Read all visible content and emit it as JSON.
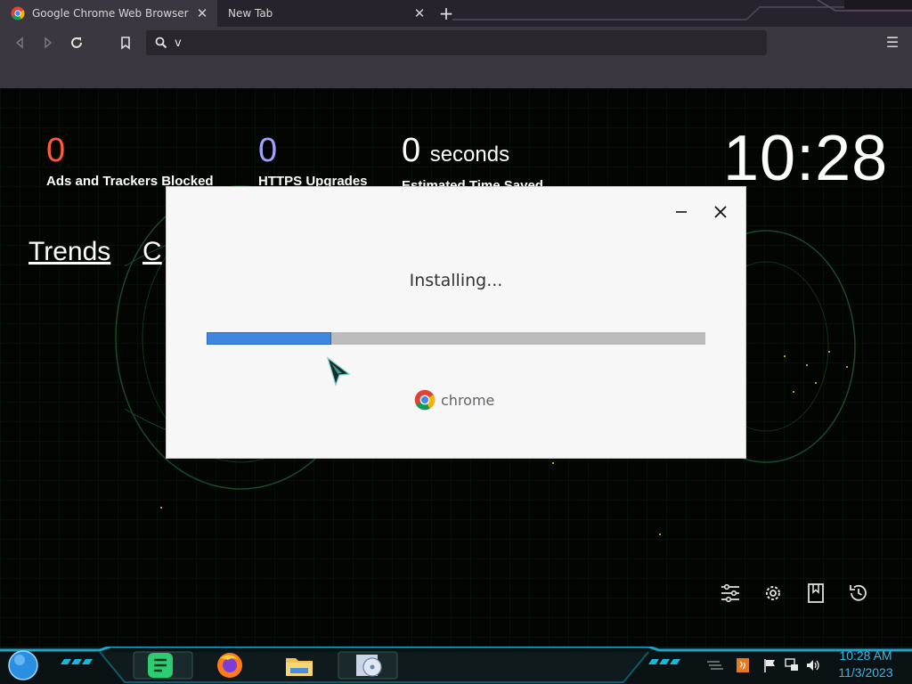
{
  "browser": {
    "tabs": [
      {
        "label": "Google Chrome Web Browser",
        "active": true
      },
      {
        "label": "New Tab",
        "active": false
      }
    ],
    "omnibox": {
      "value": "v"
    }
  },
  "ntp": {
    "stats": [
      {
        "value": "0",
        "unit": "",
        "label": "Ads and Trackers Blocked",
        "color": "#ff5a3c"
      },
      {
        "value": "0",
        "unit": "",
        "label": "HTTPS Upgrades",
        "color": "#a3a0ff"
      },
      {
        "value": "0",
        "unit": "seconds",
        "label": "Estimated Time Saved",
        "color": "#ffffff"
      }
    ],
    "clock": "10:28",
    "links": [
      "Trends",
      "C"
    ]
  },
  "dialog": {
    "title": "Installing...",
    "progress": 0.25,
    "brand": "chrome"
  },
  "taskbar": {
    "time": "10:28 AM",
    "date": "11/3/2023"
  },
  "colors": {
    "accent": "#3f86e0",
    "tray_text": "#39b6e8"
  }
}
